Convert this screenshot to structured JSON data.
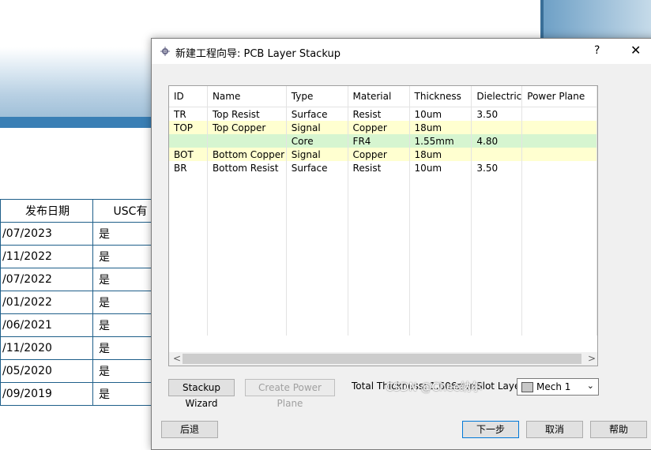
{
  "background": {
    "table": {
      "header": [
        "发布日期",
        "USC有"
      ],
      "rows": [
        [
          "/07/2023",
          "是"
        ],
        [
          "/11/2022",
          "是"
        ],
        [
          "/07/2022",
          "是"
        ],
        [
          "/01/2022",
          "是"
        ],
        [
          "/06/2021",
          "是"
        ],
        [
          "/11/2020",
          "是"
        ],
        [
          "/05/2020",
          "是"
        ],
        [
          "/09/2019",
          "是"
        ]
      ]
    }
  },
  "dialog": {
    "title": "新建工程向导: PCB Layer Stackup",
    "help_label": "?",
    "close_label": "✕",
    "grid": {
      "columns": [
        "ID",
        "Name",
        "Type",
        "Material",
        "Thickness",
        "Dielectric",
        "Power Plane"
      ],
      "rows": [
        {
          "highlight": "none",
          "cells": [
            "TR",
            "Top Resist",
            "Surface",
            "Resist",
            "10um",
            "3.50",
            ""
          ]
        },
        {
          "highlight": "yellow",
          "cells": [
            "TOP",
            "Top Copper",
            "Signal",
            "Copper",
            "18um",
            "",
            ""
          ]
        },
        {
          "highlight": "green",
          "cells": [
            "",
            "",
            "Core",
            "FR4",
            "1.55mm",
            "4.80",
            ""
          ]
        },
        {
          "highlight": "yellow",
          "cells": [
            "BOT",
            "Bottom Copper",
            "Signal",
            "Copper",
            "18um",
            "",
            ""
          ]
        },
        {
          "highlight": "none",
          "cells": [
            "BR",
            "Bottom Resist",
            "Surface",
            "Resist",
            "10um",
            "3.50",
            ""
          ]
        }
      ],
      "scroll_left": "<",
      "scroll_right": ">"
    },
    "stackup_wizard_label": "Stackup Wizard",
    "create_power_plane_label": "Create Power Plane",
    "total_thickness_label": "Total Thickness: 1.606mm",
    "slot_layer_label": "Slot Layer:",
    "slot_layer_value": "Mech 1",
    "back_label": "后退",
    "next_label": "下一步",
    "cancel_label": "取消",
    "help_btn_label": "帮助"
  },
  "watermark": "CSDN @Chee纳尔"
}
